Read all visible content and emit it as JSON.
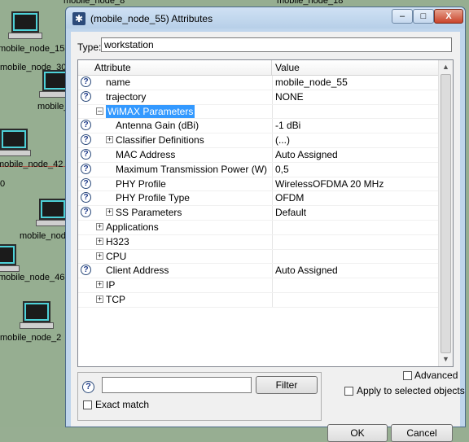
{
  "background": {
    "nodes": [
      {
        "label": "mobile_node_15"
      },
      {
        "label": "mobile_node_30"
      },
      {
        "label": "mobile_"
      },
      {
        "label": "mobile_node_42"
      },
      {
        "label": "mobile_nod"
      },
      {
        "label": "mobile_node_46"
      },
      {
        "label": "mobile_node_2"
      }
    ],
    "top_labels": [
      "mobile_node_8",
      "mobile_node_18"
    ],
    "edge_label": "0"
  },
  "window": {
    "title": "(mobile_node_55) Attributes",
    "controls": {
      "minimize": "–",
      "maximize": "□",
      "close": "X"
    }
  },
  "type_field": {
    "label": "Type:",
    "value": "workstation"
  },
  "table": {
    "headers": {
      "attribute": "Attribute",
      "value": "Value"
    },
    "rows": [
      {
        "name": "name",
        "value": "mobile_node_55",
        "help": true,
        "expander": "",
        "indent": 0,
        "selected": false
      },
      {
        "name": "trajectory",
        "value": "NONE",
        "help": true,
        "expander": "",
        "indent": 0,
        "selected": false
      },
      {
        "name": "WiMAX Parameters",
        "value": "",
        "help": false,
        "expander": "–",
        "indent": 0,
        "selected": true
      },
      {
        "name": "Antenna Gain (dBi)",
        "value": "-1 dBi",
        "help": true,
        "expander": "",
        "indent": 1,
        "selected": false
      },
      {
        "name": "Classifier Definitions",
        "value": "(...)",
        "help": true,
        "expander": "+",
        "indent": 1,
        "selected": false
      },
      {
        "name": "MAC Address",
        "value": "Auto Assigned",
        "help": true,
        "expander": "",
        "indent": 1,
        "selected": false
      },
      {
        "name": "Maximum Transmission Power (W)",
        "value": "0,5",
        "help": true,
        "expander": "",
        "indent": 1,
        "selected": false
      },
      {
        "name": "PHY Profile",
        "value": "WirelessOFDMA 20 MHz",
        "help": true,
        "expander": "",
        "indent": 1,
        "selected": false
      },
      {
        "name": "PHY Profile Type",
        "value": "OFDM",
        "help": true,
        "expander": "",
        "indent": 1,
        "selected": false
      },
      {
        "name": "SS Parameters",
        "value": "Default",
        "help": true,
        "expander": "+",
        "indent": 1,
        "selected": false
      },
      {
        "name": "Applications",
        "value": "",
        "help": false,
        "expander": "+",
        "indent": 0,
        "selected": false
      },
      {
        "name": "H323",
        "value": "",
        "help": false,
        "expander": "+",
        "indent": 0,
        "selected": false
      },
      {
        "name": "CPU",
        "value": "",
        "help": false,
        "expander": "+",
        "indent": 0,
        "selected": false
      },
      {
        "name": "Client Address",
        "value": "Auto Assigned",
        "help": true,
        "expander": "",
        "indent": 0,
        "selected": false
      },
      {
        "name": "IP",
        "value": "",
        "help": false,
        "expander": "+",
        "indent": 0,
        "selected": false
      },
      {
        "name": "TCP",
        "value": "",
        "help": false,
        "expander": "+",
        "indent": 0,
        "selected": false
      }
    ]
  },
  "search": {
    "help_glyph": "?",
    "value": "",
    "filter_label": "Filter",
    "exact_match_label": "Exact match",
    "exact_match_checked": false
  },
  "options": {
    "advanced_label": "Advanced",
    "advanced_checked": false,
    "apply_selected_label": "Apply to selected objects",
    "apply_selected_checked": false
  },
  "buttons": {
    "ok": "OK",
    "cancel": "Cancel"
  },
  "colors": {
    "selection": "#3399ff",
    "canvas": "#96ae91"
  }
}
